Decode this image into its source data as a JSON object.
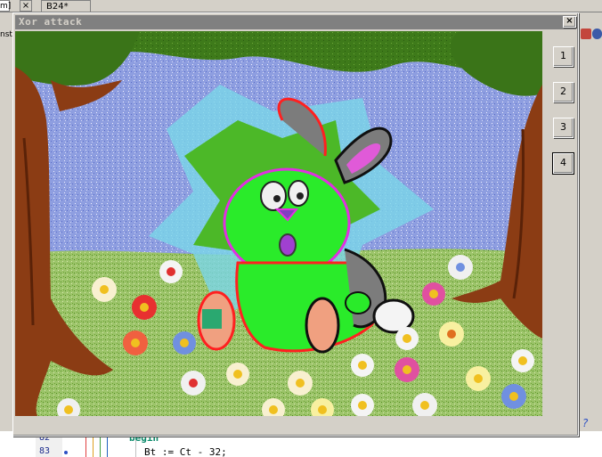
{
  "ide": {
    "tab_fragment": "m]",
    "tab_close": "×",
    "tab_b24": "B24*",
    "side_text": "nst",
    "help_mark": "?",
    "line_numbers": [
      "82",
      "83"
    ],
    "code_lines": [
      "begin",
      "Bt := Ct - 32;"
    ]
  },
  "dialog": {
    "title": "Xor attack",
    "close_label": "×",
    "buttons": [
      {
        "label": "1"
      },
      {
        "label": "2"
      },
      {
        "label": "3"
      },
      {
        "label": "4"
      }
    ],
    "selected_button": "4",
    "picture_subject": "cartoon rabbit in a flower meadow between trees"
  },
  "colors": {
    "dialog_face": "#d4d0c8",
    "titlebar": "#808080",
    "title_text": "#d4d0c8",
    "code_keyword": "#0a8a6a",
    "line_number": "#1a2a8c"
  }
}
